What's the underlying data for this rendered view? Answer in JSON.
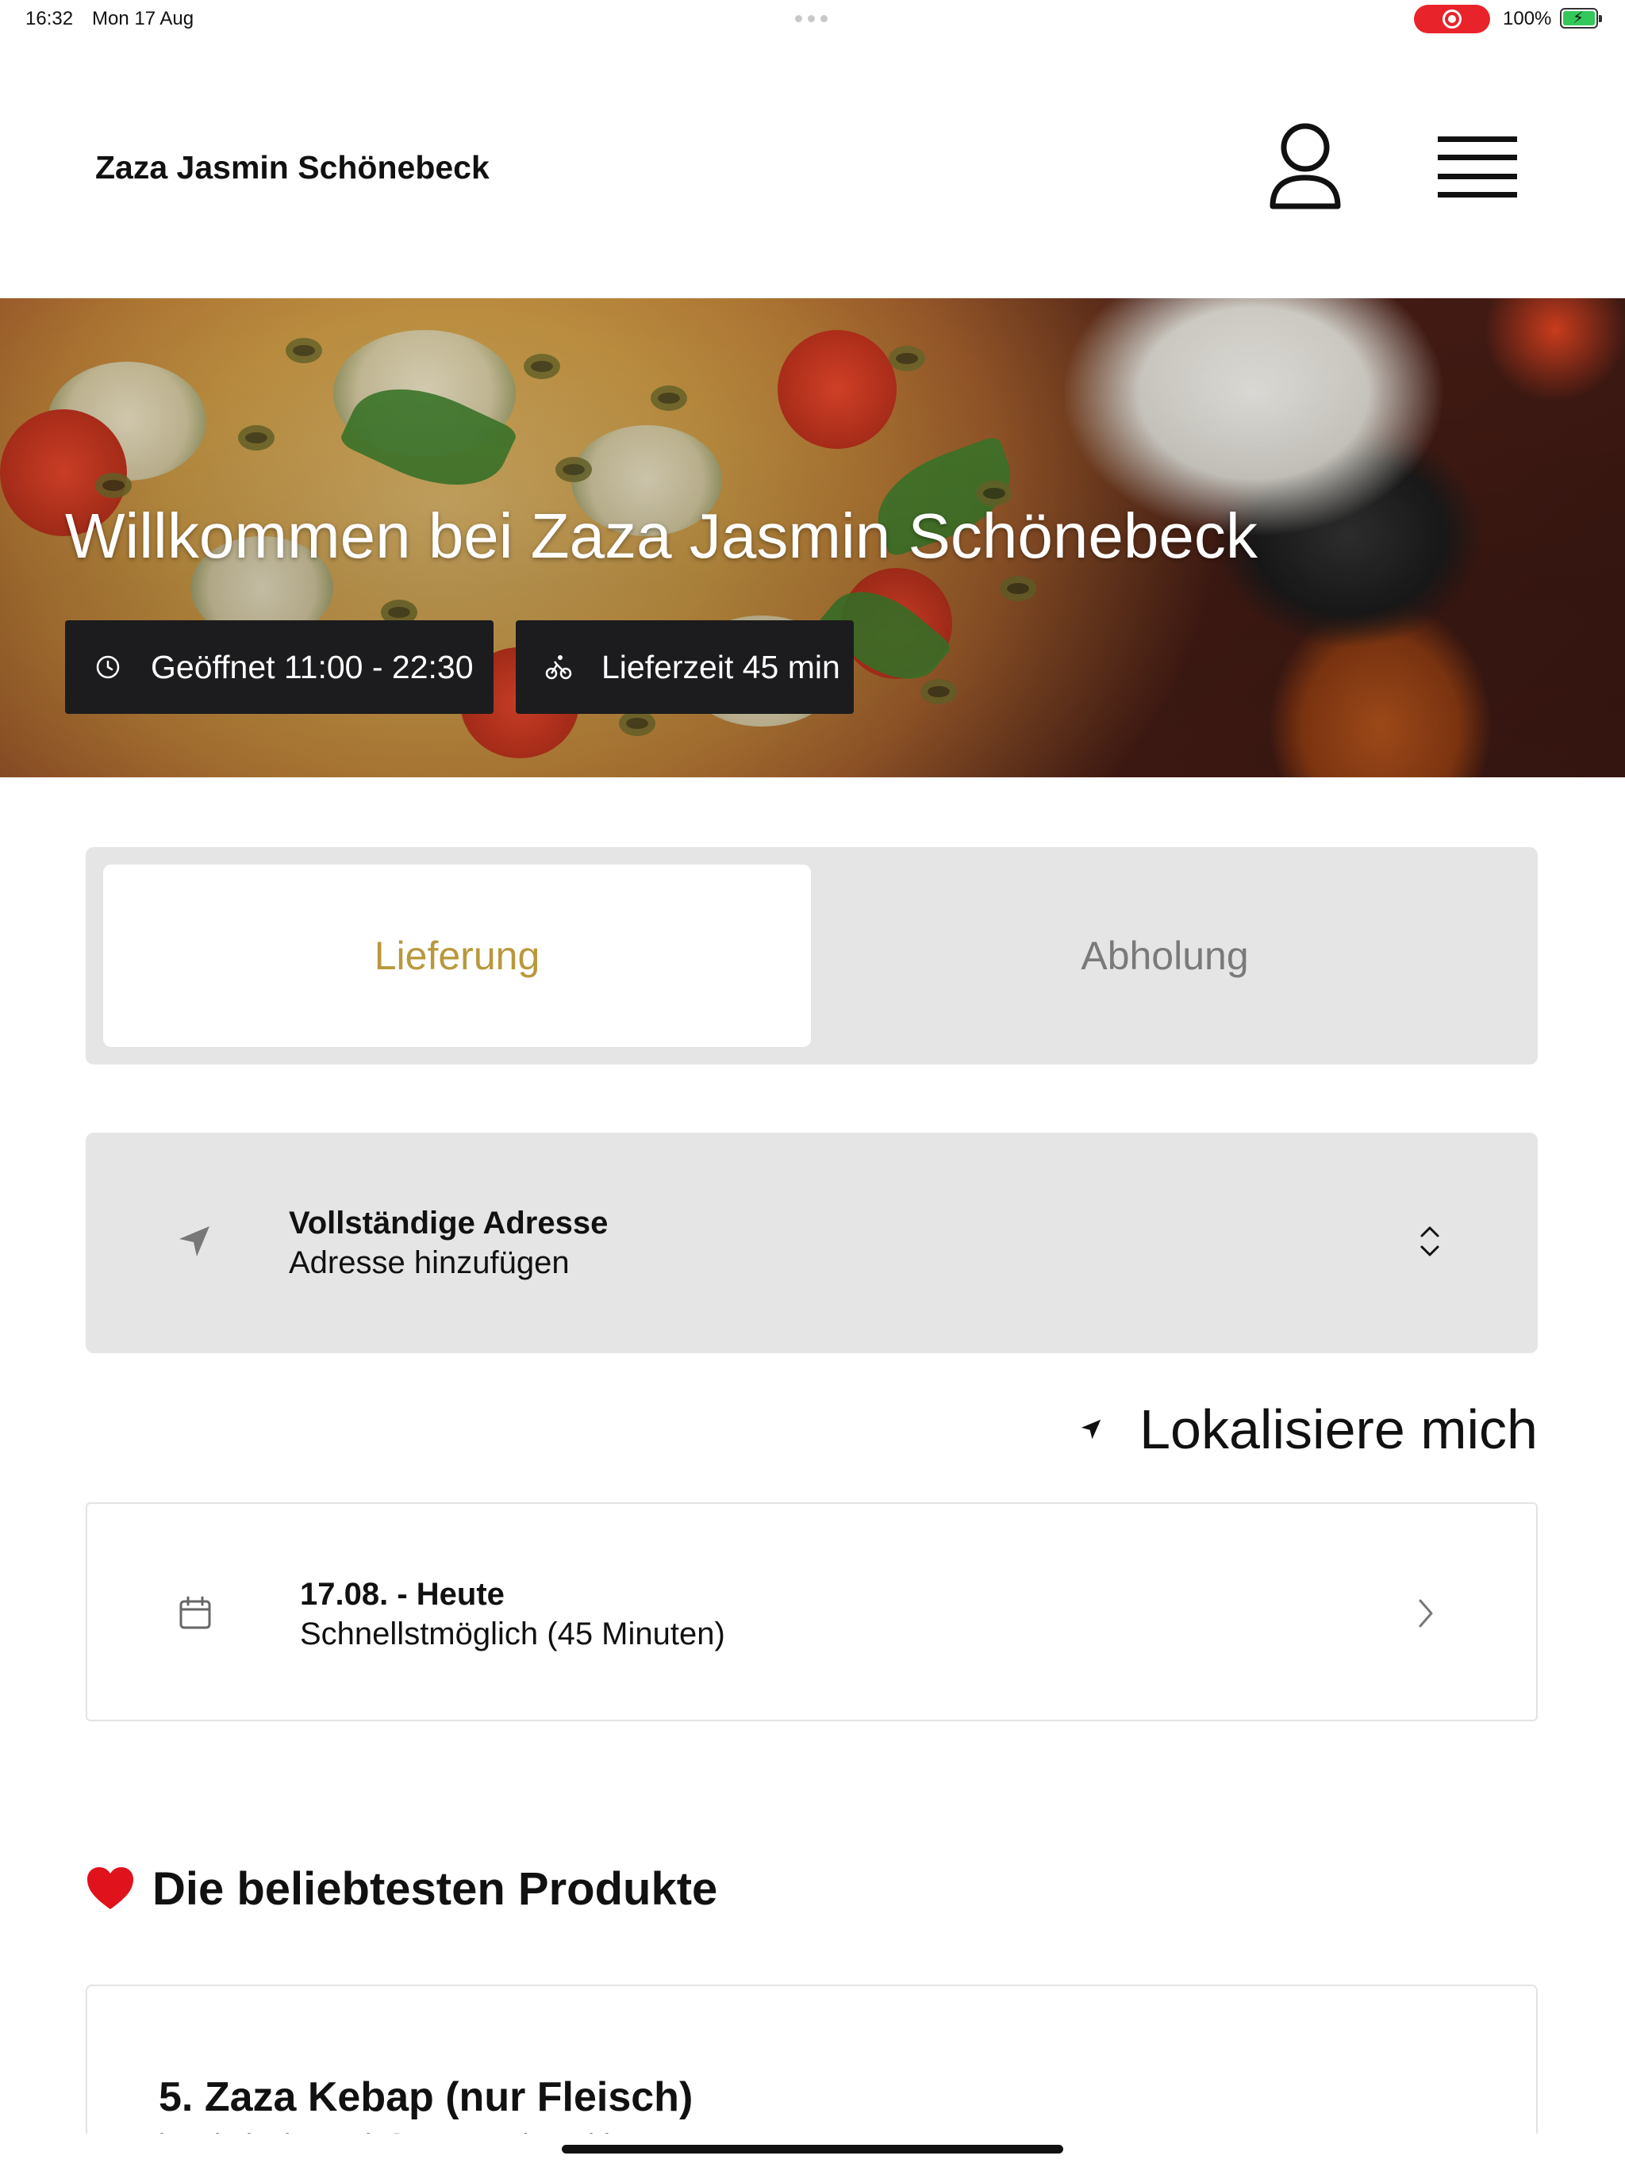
{
  "status_bar": {
    "time": "16:32",
    "date": "Mon 17 Aug",
    "battery": "100%",
    "recording_color": "#e8232a",
    "battery_color": "#34c759"
  },
  "header": {
    "brand": "Zaza Jasmin Schönebeck",
    "user_icon": "user-icon",
    "menu_icon": "hamburger-menu-icon"
  },
  "hero": {
    "title": "Willkommen bei Zaza Jasmin Schönebeck",
    "opening_hours": "Geöffnet 11:00 - 22:30",
    "delivery_time": "Lieferzeit 45 min",
    "opening_icon": "clock-icon",
    "delivery_icon": "bike-icon"
  },
  "order_mode": {
    "tabs": [
      {
        "label": "Lieferung",
        "active": true
      },
      {
        "label": "Abholung",
        "active": false
      }
    ],
    "accent_color": "#b9983c"
  },
  "address": {
    "title": "Vollständige Adresse",
    "placeholder": "Adresse hinzufügen",
    "icon": "location-arrow-icon",
    "chevron_icon": "chevron-up-down-icon"
  },
  "locate": {
    "label": "Lokalisiere mich",
    "icon": "location-arrow-icon"
  },
  "schedule": {
    "title": "17.08. - Heute",
    "subtitle": "Schnellstmöglich (45 Minuten)",
    "icon": "calendar-icon",
    "chevron_icon": "chevron-right-icon"
  },
  "popular": {
    "title": "Die beliebtesten Produkte",
    "icon": "heart-icon",
    "products": [
      {
        "name": "5. Zaza Kebap (nur Fleisch)",
        "description": "im Fladenbrot mit Sauce nach Wahl"
      }
    ]
  }
}
